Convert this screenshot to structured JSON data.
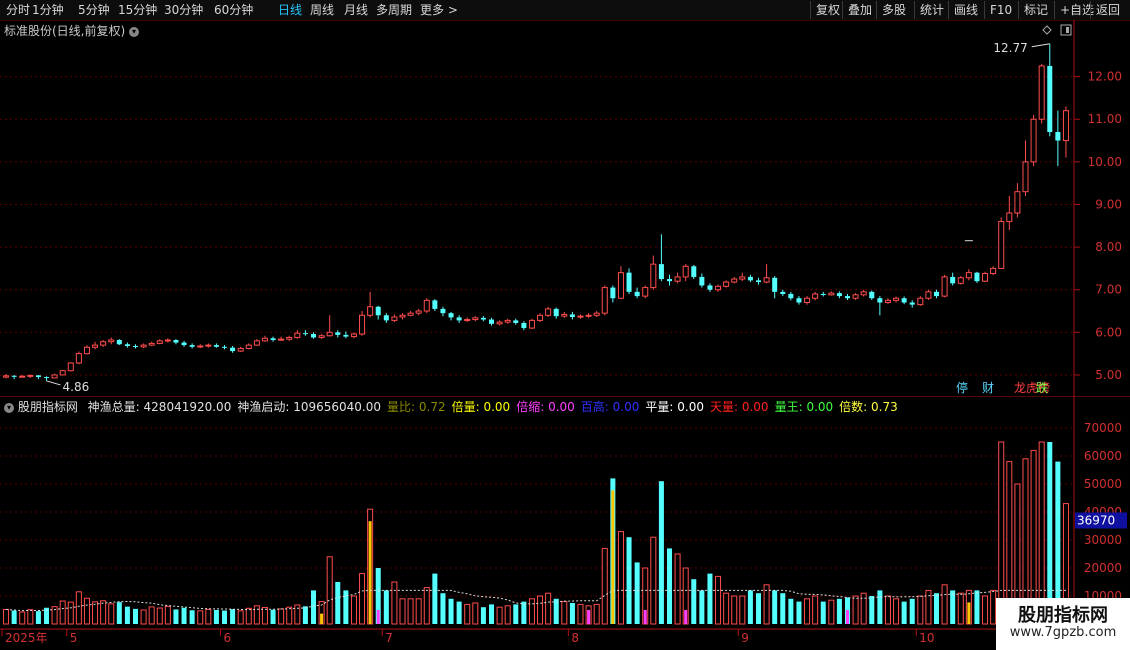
{
  "toolbar": {
    "periods": [
      "分时",
      "1分钟",
      "5分钟",
      "15分钟",
      "30分钟",
      "60分钟",
      "日线",
      "周线",
      "月线",
      "多周期",
      "更多 >"
    ],
    "active": "日线",
    "right_buttons": [
      "复权",
      "叠加",
      "多股",
      "统计",
      "画线",
      "F10",
      "标记",
      "+自选",
      "返回"
    ]
  },
  "price_chart": {
    "title": "标准股份(日线,前复权)",
    "y_ticks": [
      "12.00",
      "11.00",
      "10.00",
      "9.00",
      "8.00",
      "7.00",
      "6.00",
      "5.00"
    ],
    "max_label": "12.77",
    "min_label": "4.86",
    "badges": [
      {
        "text": "停",
        "color": "#5ad8ff"
      },
      {
        "text": "财",
        "color": "#5ad8ff"
      },
      {
        "text": "龙虎榜",
        "color": "#ff4040"
      },
      {
        "text": "跌",
        "color": "#7cff4a"
      }
    ]
  },
  "volume_panel": {
    "indicator_name": "股朋指标网",
    "items": [
      {
        "label": "神渔总量:",
        "value": "428041920.00",
        "color": "#e0e0e0"
      },
      {
        "label": "神渔启动:",
        "value": "109656040.00",
        "color": "#e0e0e0"
      },
      {
        "label": "量比:",
        "value": "0.72",
        "color": "#8a8a00"
      },
      {
        "label": "倍量:",
        "value": "0.00",
        "color": "#ffff00"
      },
      {
        "label": "倍缩:",
        "value": "0.00",
        "color": "#ff40ff"
      },
      {
        "label": "百高:",
        "value": "0.00",
        "color": "#3030ff"
      },
      {
        "label": "平量:",
        "value": "0.00",
        "color": "#ffffff"
      },
      {
        "label": "天量:",
        "value": "0.00",
        "color": "#ff2020"
      },
      {
        "label": "量王:",
        "value": "0.00",
        "color": "#40ff40"
      },
      {
        "label": "倍数:",
        "value": "0.73",
        "color": "#ffff40"
      }
    ],
    "y_ticks": [
      "70000",
      "60000",
      "50000",
      "40000",
      "30000",
      "20000",
      "10000"
    ],
    "current_marker": "36970"
  },
  "x_axis": {
    "labels": [
      "2025年",
      "5",
      "6",
      "7",
      "8",
      "9",
      "10"
    ]
  },
  "watermark": {
    "line1": "股朋指标网",
    "line2": "www.7gpzb.com"
  },
  "colors": {
    "up": "#ff4d4d",
    "down": "#54ffff",
    "grid": "#5a0000",
    "axis": "#b01010",
    "yellow": "#ffc400",
    "magenta": "#ff40ff",
    "marker_bg": "#1010a0"
  },
  "chart_data": {
    "type": "candlestick",
    "price_range": [
      4.6,
      13.0
    ],
    "volume_range": [
      0,
      80000
    ],
    "months": [
      {
        "label": "2025年",
        "index": 0
      },
      {
        "label": "5",
        "index": 8
      },
      {
        "label": "6",
        "index": 27
      },
      {
        "label": "7",
        "index": 47
      },
      {
        "label": "8",
        "index": 70
      },
      {
        "label": "9",
        "index": 91
      },
      {
        "label": "10",
        "index": 113
      }
    ],
    "candles": [
      [
        4.95,
        4.98,
        5.02,
        4.92,
        5200
      ],
      [
        4.98,
        4.96,
        5.0,
        4.9,
        4800
      ],
      [
        4.96,
        4.97,
        5.0,
        4.94,
        4300
      ],
      [
        4.97,
        4.99,
        5.01,
        4.93,
        5100
      ],
      [
        4.99,
        4.95,
        5.0,
        4.9,
        4600
      ],
      [
        4.95,
        4.93,
        4.97,
        4.86,
        5800
      ],
      [
        4.93,
        5.0,
        5.03,
        4.92,
        6200
      ],
      [
        5.0,
        5.1,
        5.12,
        4.99,
        8200
      ],
      [
        5.1,
        5.28,
        5.3,
        5.08,
        7800
      ],
      [
        5.28,
        5.5,
        5.55,
        5.25,
        11500
      ],
      [
        5.5,
        5.65,
        5.7,
        5.48,
        9200
      ],
      [
        5.65,
        5.7,
        5.78,
        5.6,
        7900
      ],
      [
        5.7,
        5.78,
        5.82,
        5.66,
        8300
      ],
      [
        5.78,
        5.82,
        5.88,
        5.72,
        7200
      ],
      [
        5.82,
        5.72,
        5.84,
        5.7,
        7800
      ],
      [
        5.72,
        5.68,
        5.76,
        5.64,
        6200
      ],
      [
        5.68,
        5.66,
        5.72,
        5.62,
        5400
      ],
      [
        5.66,
        5.7,
        5.74,
        5.63,
        5000
      ],
      [
        5.7,
        5.74,
        5.78,
        5.68,
        6100
      ],
      [
        5.74,
        5.8,
        5.84,
        5.72,
        5700
      ],
      [
        5.8,
        5.82,
        5.86,
        5.76,
        6300
      ],
      [
        5.82,
        5.76,
        5.84,
        5.72,
        5200
      ],
      [
        5.76,
        5.7,
        5.8,
        5.66,
        5800
      ],
      [
        5.7,
        5.66,
        5.74,
        5.62,
        4900
      ],
      [
        5.66,
        5.68,
        5.72,
        5.63,
        4700
      ],
      [
        5.68,
        5.7,
        5.74,
        5.64,
        5200
      ],
      [
        5.7,
        5.66,
        5.74,
        5.64,
        5000
      ],
      [
        5.66,
        5.64,
        5.7,
        5.6,
        4800
      ],
      [
        5.64,
        5.56,
        5.68,
        5.52,
        5300
      ],
      [
        5.56,
        5.62,
        5.66,
        5.54,
        4700
      ],
      [
        5.62,
        5.7,
        5.74,
        5.6,
        5600
      ],
      [
        5.7,
        5.8,
        5.84,
        5.68,
        6500
      ],
      [
        5.8,
        5.86,
        5.92,
        5.78,
        5900
      ],
      [
        5.86,
        5.82,
        5.9,
        5.78,
        5100
      ],
      [
        5.82,
        5.84,
        5.9,
        5.8,
        5400
      ],
      [
        5.84,
        5.88,
        5.92,
        5.8,
        6000
      ],
      [
        5.88,
        5.98,
        6.05,
        5.85,
        6800
      ],
      [
        5.98,
        5.96,
        6.05,
        5.92,
        6300
      ],
      [
        5.96,
        5.88,
        6.0,
        5.85,
        12000
      ],
      [
        5.88,
        5.92,
        5.96,
        5.84,
        8000
      ],
      [
        5.92,
        6.0,
        6.4,
        5.9,
        24000
      ],
      [
        6.0,
        5.94,
        6.05,
        5.88,
        15000
      ],
      [
        5.94,
        5.9,
        6.02,
        5.86,
        12000
      ],
      [
        5.9,
        5.96,
        6.0,
        5.86,
        10000
      ],
      [
        5.96,
        6.4,
        6.5,
        5.92,
        18000
      ],
      [
        6.4,
        6.6,
        6.95,
        6.35,
        41000
      ],
      [
        6.6,
        6.4,
        6.62,
        6.3,
        20000
      ],
      [
        6.4,
        6.28,
        6.45,
        6.22,
        12000
      ],
      [
        6.28,
        6.36,
        6.42,
        6.24,
        15000
      ],
      [
        6.36,
        6.4,
        6.45,
        6.3,
        9000
      ],
      [
        6.4,
        6.45,
        6.5,
        6.38,
        9000
      ],
      [
        6.45,
        6.5,
        6.55,
        6.4,
        9000
      ],
      [
        6.5,
        6.75,
        6.8,
        6.45,
        13000
      ],
      [
        6.75,
        6.55,
        6.78,
        6.5,
        18000
      ],
      [
        6.55,
        6.45,
        6.6,
        6.38,
        11000
      ],
      [
        6.45,
        6.35,
        6.48,
        6.28,
        9000
      ],
      [
        6.35,
        6.28,
        6.4,
        6.22,
        8000
      ],
      [
        6.28,
        6.3,
        6.35,
        6.24,
        7000
      ],
      [
        6.3,
        6.34,
        6.38,
        6.26,
        7500
      ],
      [
        6.34,
        6.3,
        6.38,
        6.26,
        6000
      ],
      [
        6.3,
        6.2,
        6.34,
        6.16,
        7000
      ],
      [
        6.2,
        6.24,
        6.28,
        6.16,
        6000
      ],
      [
        6.24,
        6.28,
        6.32,
        6.2,
        6500
      ],
      [
        6.28,
        6.22,
        6.32,
        6.18,
        7000
      ],
      [
        6.22,
        6.1,
        6.26,
        6.05,
        8000
      ],
      [
        6.1,
        6.28,
        6.32,
        6.08,
        9000
      ],
      [
        6.28,
        6.4,
        6.45,
        6.24,
        10000
      ],
      [
        6.4,
        6.55,
        6.6,
        6.36,
        11000
      ],
      [
        6.55,
        6.38,
        6.58,
        6.32,
        9000
      ],
      [
        6.38,
        6.42,
        6.48,
        6.34,
        8000
      ],
      [
        6.42,
        6.36,
        6.48,
        6.3,
        7500
      ],
      [
        6.36,
        6.38,
        6.42,
        6.32,
        7000
      ],
      [
        6.38,
        6.4,
        6.45,
        6.34,
        6500
      ],
      [
        6.4,
        6.45,
        6.5,
        6.36,
        7000
      ],
      [
        6.45,
        7.05,
        7.1,
        6.4,
        27000
      ],
      [
        7.05,
        6.8,
        7.1,
        6.7,
        52000
      ],
      [
        6.8,
        7.4,
        7.55,
        6.78,
        33000
      ],
      [
        7.4,
        6.95,
        7.5,
        6.9,
        31000
      ],
      [
        6.95,
        6.85,
        7.05,
        6.8,
        22000
      ],
      [
        6.85,
        7.05,
        7.1,
        6.8,
        20000
      ],
      [
        7.05,
        7.6,
        7.8,
        7.0,
        31000
      ],
      [
        7.6,
        7.25,
        8.3,
        7.2,
        51000
      ],
      [
        7.25,
        7.2,
        7.35,
        7.1,
        27000
      ],
      [
        7.2,
        7.3,
        7.4,
        7.15,
        25000
      ],
      [
        7.3,
        7.55,
        7.6,
        7.2,
        20000
      ],
      [
        7.55,
        7.3,
        7.58,
        7.25,
        16000
      ],
      [
        7.3,
        7.1,
        7.38,
        7.05,
        12000
      ],
      [
        7.1,
        7.0,
        7.15,
        6.95,
        18000
      ],
      [
        7.0,
        7.08,
        7.12,
        6.95,
        17000
      ],
      [
        7.08,
        7.18,
        7.22,
        7.05,
        11000
      ],
      [
        7.18,
        7.25,
        7.3,
        7.15,
        10000
      ],
      [
        7.25,
        7.3,
        7.4,
        7.2,
        10000
      ],
      [
        7.3,
        7.22,
        7.35,
        7.18,
        12000
      ],
      [
        7.22,
        7.18,
        7.28,
        7.12,
        11000
      ],
      [
        7.18,
        7.28,
        7.6,
        7.15,
        14000
      ],
      [
        7.28,
        6.95,
        7.32,
        6.8,
        12000
      ],
      [
        6.95,
        6.9,
        7.0,
        6.85,
        11000
      ],
      [
        6.9,
        6.8,
        6.95,
        6.75,
        9000
      ],
      [
        6.8,
        6.7,
        6.85,
        6.65,
        8000
      ],
      [
        6.7,
        6.8,
        6.85,
        6.65,
        9000
      ],
      [
        6.8,
        6.9,
        6.95,
        6.75,
        10000
      ],
      [
        6.9,
        6.88,
        6.95,
        6.84,
        8000
      ],
      [
        6.88,
        6.92,
        6.96,
        6.86,
        8500
      ],
      [
        6.92,
        6.85,
        6.96,
        6.8,
        9000
      ],
      [
        6.85,
        6.8,
        6.9,
        6.76,
        9500
      ],
      [
        6.8,
        6.88,
        6.92,
        6.76,
        10000
      ],
      [
        6.88,
        6.95,
        7.0,
        6.84,
        11000
      ],
      [
        6.95,
        6.8,
        6.98,
        6.76,
        10000
      ],
      [
        6.8,
        6.7,
        6.85,
        6.4,
        12000
      ],
      [
        6.7,
        6.75,
        6.8,
        6.66,
        10000
      ],
      [
        6.75,
        6.8,
        6.84,
        6.7,
        9000
      ],
      [
        6.8,
        6.7,
        6.84,
        6.66,
        8000
      ],
      [
        6.7,
        6.65,
        6.75,
        6.58,
        9000
      ],
      [
        6.65,
        6.8,
        6.85,
        6.62,
        10000
      ],
      [
        6.8,
        6.95,
        7.0,
        6.76,
        12000
      ],
      [
        6.95,
        6.85,
        7.0,
        6.8,
        11000
      ],
      [
        6.85,
        7.3,
        7.35,
        6.82,
        14000
      ],
      [
        7.3,
        7.15,
        7.4,
        7.1,
        12000
      ],
      [
        7.15,
        7.28,
        7.32,
        7.12,
        11000
      ],
      [
        7.28,
        7.4,
        7.48,
        7.22,
        12000
      ],
      [
        7.4,
        7.2,
        7.42,
        7.16,
        12000
      ],
      [
        7.2,
        7.38,
        7.42,
        7.18,
        10000
      ],
      [
        7.38,
        7.5,
        7.55,
        7.34,
        12000
      ],
      [
        7.5,
        8.6,
        8.7,
        7.96,
        65000
      ],
      [
        8.6,
        8.8,
        9.2,
        8.4,
        58000
      ],
      [
        8.8,
        9.3,
        9.5,
        8.7,
        50000
      ],
      [
        9.3,
        10.0,
        10.5,
        9.2,
        59000
      ],
      [
        10.0,
        11.0,
        11.1,
        9.9,
        62000
      ],
      [
        11.0,
        12.25,
        12.3,
        10.9,
        65000
      ],
      [
        12.25,
        10.7,
        12.77,
        10.6,
        65000
      ],
      [
        10.7,
        10.5,
        11.2,
        9.9,
        58000
      ],
      [
        10.5,
        11.2,
        11.3,
        10.1,
        43000
      ]
    ]
  }
}
